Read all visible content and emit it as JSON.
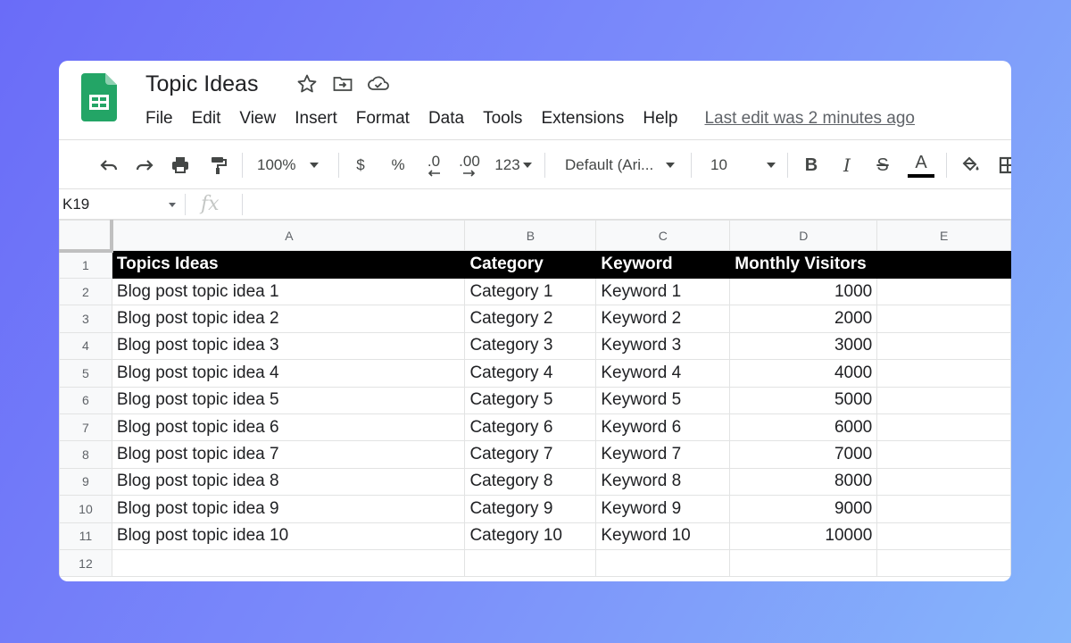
{
  "app": {
    "doc_title": "Topic Ideas",
    "menu": [
      "File",
      "Edit",
      "View",
      "Insert",
      "Format",
      "Data",
      "Tools",
      "Extensions",
      "Help"
    ],
    "last_edit": "Last edit was 2 minutes ago",
    "brand_color": "#23a566"
  },
  "toolbar": {
    "zoom": "100%",
    "currency": "$",
    "percent": "%",
    "decrease_decimal": ".0",
    "increase_decimal": ".00",
    "number_format": "123",
    "font": "Default (Ari...",
    "font_size": "10",
    "bold": "B",
    "italic": "I",
    "strikethrough": "S",
    "text_color_letter": "A"
  },
  "formula_bar": {
    "name_box": "K19",
    "fx": "fx"
  },
  "sheet": {
    "columns": [
      "A",
      "B",
      "C",
      "D",
      "E"
    ],
    "row_numbers": [
      "1",
      "2",
      "3",
      "4",
      "5",
      "6",
      "7",
      "8",
      "9",
      "10",
      "11",
      "12"
    ],
    "header": [
      "Topics Ideas",
      "Category",
      "Keyword",
      "Monthly Visitors",
      ""
    ],
    "rows": [
      [
        "Blog post topic idea 1",
        "Category 1",
        "Keyword 1",
        "1000",
        ""
      ],
      [
        "Blog post topic idea 2",
        "Category 2",
        "Keyword 2",
        "2000",
        ""
      ],
      [
        "Blog post topic idea 3",
        "Category 3",
        "Keyword 3",
        "3000",
        ""
      ],
      [
        "Blog post topic idea 4",
        "Category 4",
        "Keyword 4",
        "4000",
        ""
      ],
      [
        "Blog post topic idea 5",
        "Category 5",
        "Keyword 5",
        "5000",
        ""
      ],
      [
        "Blog post topic idea 6",
        "Category 6",
        "Keyword 6",
        "6000",
        ""
      ],
      [
        "Blog post topic idea 7",
        "Category 7",
        "Keyword 7",
        "7000",
        ""
      ],
      [
        "Blog post topic idea 8",
        "Category 8",
        "Keyword 8",
        "8000",
        ""
      ],
      [
        "Blog post topic idea 9",
        "Category 9",
        "Keyword 9",
        "9000",
        ""
      ],
      [
        "Blog post topic idea 10",
        "Category 10",
        "Keyword 10",
        "10000",
        ""
      ],
      [
        "",
        "",
        "",
        "",
        ""
      ]
    ]
  }
}
